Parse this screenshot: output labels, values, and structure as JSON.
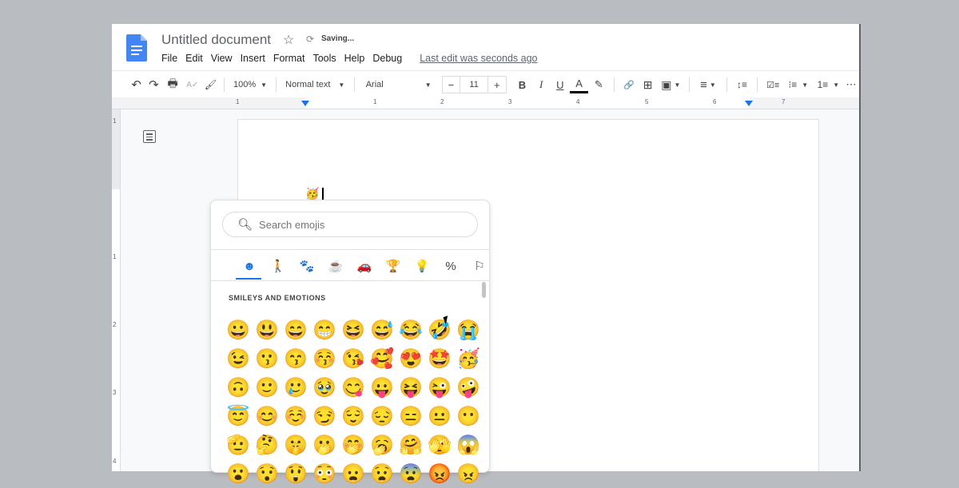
{
  "header": {
    "title": "Untitled document",
    "status": "Saving...",
    "menu": [
      "File",
      "Edit",
      "View",
      "Insert",
      "Format",
      "Tools",
      "Help",
      "Debug"
    ],
    "last_edit": "Last edit was seconds ago"
  },
  "toolbar": {
    "undo": "↶",
    "redo": "↷",
    "print": "🖶",
    "spellcheck": "A✓",
    "paint_format": "🖌",
    "zoom": "100%",
    "style": "Normal text",
    "font": "Arial",
    "font_size_minus": "−",
    "font_size": "11",
    "font_size_plus": "+",
    "bold": "B",
    "italic": "I",
    "underline": "U",
    "text_color": "A",
    "highlight": "✎",
    "link": "🔗",
    "comment": "⊞",
    "image": "▣",
    "align": "≡",
    "line_spacing": "↕≡",
    "checklist": "☑≡",
    "bullets": "⁝≡",
    "numbered": "1≡",
    "more": "⋯"
  },
  "ruler": {
    "labels": [
      "1",
      "1",
      "2",
      "3",
      "4",
      "5",
      "6",
      "7"
    ],
    "vertical_labels": [
      "1",
      "1",
      "2",
      "3",
      "4"
    ]
  },
  "document": {
    "inserted_emoji": "🥳"
  },
  "emoji_picker": {
    "search_placeholder": "Search emojis",
    "categories": [
      {
        "name": "smileys",
        "glyph": "☻",
        "active": true
      },
      {
        "name": "people",
        "glyph": "🚶"
      },
      {
        "name": "animals",
        "glyph": "🐾"
      },
      {
        "name": "food",
        "glyph": "☕"
      },
      {
        "name": "travel",
        "glyph": "🚗"
      },
      {
        "name": "activities",
        "glyph": "🏆"
      },
      {
        "name": "objects",
        "glyph": "💡"
      },
      {
        "name": "symbols",
        "glyph": "%"
      },
      {
        "name": "flags",
        "glyph": "⚐"
      }
    ],
    "section_title": "SMILEYS AND EMOTIONS",
    "emojis": [
      "😀",
      "😃",
      "😄",
      "😁",
      "😆",
      "😅",
      "😂",
      "🤣",
      "😭",
      "😉",
      "😗",
      "😙",
      "😚",
      "😘",
      "🥰",
      "😍",
      "🤩",
      "🥳",
      "🙃",
      "🙂",
      "🥲",
      "🥹",
      "😋",
      "😛",
      "😝",
      "😜",
      "🤪",
      "😇",
      "😊",
      "☺️",
      "😏",
      "😌",
      "😔",
      "😑",
      "😐",
      "😶",
      "🫡",
      "🤔",
      "🤫",
      "🫢",
      "🤭",
      "🥱",
      "🤗",
      "🫣",
      "😱",
      "😮",
      "😯",
      "😲",
      "😳",
      "😦",
      "😧",
      "😨",
      "😡",
      "😠"
    ]
  }
}
